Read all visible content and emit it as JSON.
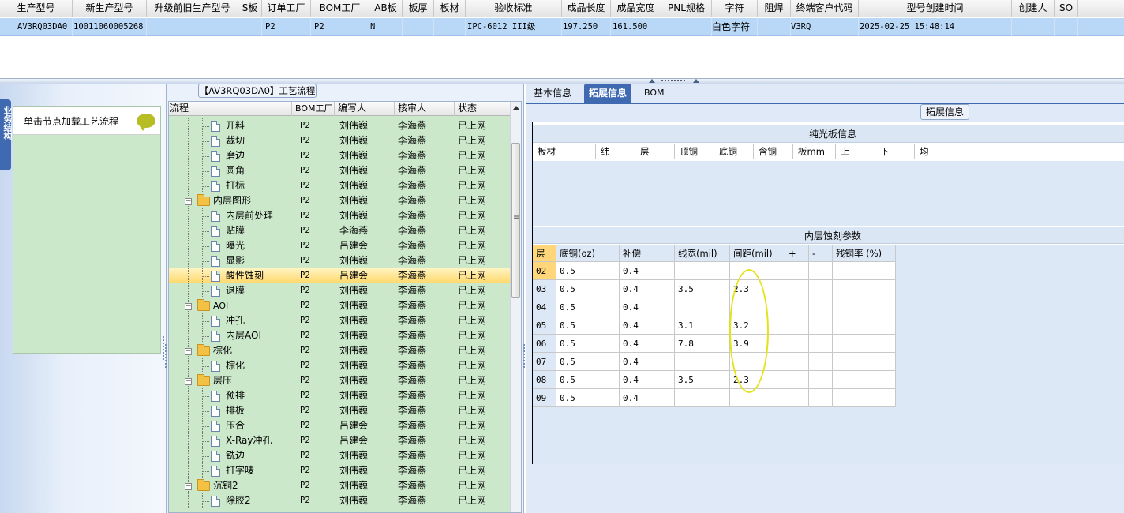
{
  "top_grid": {
    "columns": [
      "生产型号",
      "新生产型号",
      "升级前旧生产型号",
      "S板",
      "订单工厂",
      "BOM工厂",
      "AB板",
      "板厚",
      "板材",
      "验收标准",
      "成品长度",
      "成品宽度",
      "PNL规格",
      "字符",
      "阻焊",
      "终端客户代码",
      "型号创建时间",
      "创建人",
      "SO"
    ],
    "row": {
      "model": "AV3RQ03DA0",
      "new_model": "10011060005268",
      "order_factory": "P2",
      "bom_factory": "P2",
      "ab_board": "N",
      "standard": "IPC-6012 III级",
      "length": "197.250",
      "width": "161.500",
      "char": "白色字符",
      "customer_code": "V3RQ",
      "created": "2025-02-25 15:48:14"
    }
  },
  "left_nav": {
    "vtab_label": "业务结构",
    "header_text": "单击节点加载工艺流程"
  },
  "tree": {
    "title": "【AV3RQ03DA0】工艺流程",
    "columns": [
      "流程",
      "BOM工厂",
      "编写人",
      "核审人",
      "状态"
    ],
    "rows": [
      {
        "name": "开料",
        "factory": "P2",
        "writer": "刘伟巍",
        "reviewer": "李海燕",
        "status": "已上网",
        "level": 1,
        "type": "file"
      },
      {
        "name": "裁切",
        "factory": "P2",
        "writer": "刘伟巍",
        "reviewer": "李海燕",
        "status": "已上网",
        "level": 1,
        "type": "file"
      },
      {
        "name": "磨边",
        "factory": "P2",
        "writer": "刘伟巍",
        "reviewer": "李海燕",
        "status": "已上网",
        "level": 1,
        "type": "file"
      },
      {
        "name": "圆角",
        "factory": "P2",
        "writer": "刘伟巍",
        "reviewer": "李海燕",
        "status": "已上网",
        "level": 1,
        "type": "file"
      },
      {
        "name": "打标",
        "factory": "P2",
        "writer": "刘伟巍",
        "reviewer": "李海燕",
        "status": "已上网",
        "level": 1,
        "type": "file"
      },
      {
        "name": "内层图形",
        "factory": "P2",
        "writer": "刘伟巍",
        "reviewer": "李海燕",
        "status": "已上网",
        "level": 0,
        "type": "folder"
      },
      {
        "name": "内层前处理",
        "factory": "P2",
        "writer": "刘伟巍",
        "reviewer": "李海燕",
        "status": "已上网",
        "level": 1,
        "type": "file"
      },
      {
        "name": "贴膜",
        "factory": "P2",
        "writer": "李海燕",
        "reviewer": "李海燕",
        "status": "已上网",
        "level": 1,
        "type": "file"
      },
      {
        "name": "曝光",
        "factory": "P2",
        "writer": "吕建会",
        "reviewer": "李海燕",
        "status": "已上网",
        "level": 1,
        "type": "file"
      },
      {
        "name": "显影",
        "factory": "P2",
        "writer": "刘伟巍",
        "reviewer": "李海燕",
        "status": "已上网",
        "level": 1,
        "type": "file"
      },
      {
        "name": "酸性蚀刻",
        "factory": "P2",
        "writer": "吕建会",
        "reviewer": "李海燕",
        "status": "已上网",
        "level": 1,
        "type": "file",
        "selected": true
      },
      {
        "name": "退膜",
        "factory": "P2",
        "writer": "刘伟巍",
        "reviewer": "李海燕",
        "status": "已上网",
        "level": 1,
        "type": "file"
      },
      {
        "name": "AOI",
        "factory": "P2",
        "writer": "刘伟巍",
        "reviewer": "李海燕",
        "status": "已上网",
        "level": 0,
        "type": "folder"
      },
      {
        "name": "冲孔",
        "factory": "P2",
        "writer": "刘伟巍",
        "reviewer": "李海燕",
        "status": "已上网",
        "level": 1,
        "type": "file"
      },
      {
        "name": "内层AOI",
        "factory": "P2",
        "writer": "刘伟巍",
        "reviewer": "李海燕",
        "status": "已上网",
        "level": 1,
        "type": "file"
      },
      {
        "name": "棕化",
        "factory": "P2",
        "writer": "刘伟巍",
        "reviewer": "李海燕",
        "status": "已上网",
        "level": 0,
        "type": "folder"
      },
      {
        "name": "棕化",
        "factory": "P2",
        "writer": "刘伟巍",
        "reviewer": "李海燕",
        "status": "已上网",
        "level": 1,
        "type": "file"
      },
      {
        "name": "层压",
        "factory": "P2",
        "writer": "刘伟巍",
        "reviewer": "李海燕",
        "status": "已上网",
        "level": 0,
        "type": "folder"
      },
      {
        "name": "预排",
        "factory": "P2",
        "writer": "刘伟巍",
        "reviewer": "李海燕",
        "status": "已上网",
        "level": 1,
        "type": "file"
      },
      {
        "name": "排板",
        "factory": "P2",
        "writer": "刘伟巍",
        "reviewer": "李海燕",
        "status": "已上网",
        "level": 1,
        "type": "file"
      },
      {
        "name": "压合",
        "factory": "P2",
        "writer": "吕建会",
        "reviewer": "李海燕",
        "status": "已上网",
        "level": 1,
        "type": "file"
      },
      {
        "name": "X-Ray冲孔",
        "factory": "P2",
        "writer": "吕建会",
        "reviewer": "李海燕",
        "status": "已上网",
        "level": 1,
        "type": "file"
      },
      {
        "name": "铣边",
        "factory": "P2",
        "writer": "刘伟巍",
        "reviewer": "李海燕",
        "status": "已上网",
        "level": 1,
        "type": "file"
      },
      {
        "name": "打字唛",
        "factory": "P2",
        "writer": "刘伟巍",
        "reviewer": "李海燕",
        "status": "已上网",
        "level": 1,
        "type": "file"
      },
      {
        "name": "沉铜2",
        "factory": "P2",
        "writer": "刘伟巍",
        "reviewer": "李海燕",
        "status": "已上网",
        "level": 0,
        "type": "folder"
      },
      {
        "name": "除胶2",
        "factory": "P2",
        "writer": "刘伟巍",
        "reviewer": "李海燕",
        "status": "已上网",
        "level": 1,
        "type": "file"
      }
    ]
  },
  "right": {
    "tabs": [
      "基本信息",
      "拓展信息",
      "BOM"
    ],
    "active_tab": 1,
    "ext_title": "拓展信息",
    "section1": {
      "title": "纯光板信息",
      "columns": [
        "板材",
        "纬",
        "层",
        "顶铜",
        "底铜",
        "含铜",
        "板mm",
        "上",
        "下",
        "均"
      ]
    },
    "section2": {
      "title": "内层蚀刻参数",
      "columns": [
        "层",
        "底铜(oz)",
        "补偿",
        "线宽(mil)",
        "间距(mil)",
        "+",
        "-",
        "残铜率 (%)"
      ],
      "rows": [
        [
          "02",
          "0.5",
          "0.4",
          "",
          "",
          "",
          "",
          ""
        ],
        [
          "03",
          "0.5",
          "0.4",
          "3.5",
          "2.3",
          "",
          "",
          ""
        ],
        [
          "04",
          "0.5",
          "0.4",
          "",
          "",
          "",
          "",
          ""
        ],
        [
          "05",
          "0.5",
          "0.4",
          "3.1",
          "3.2",
          "",
          "",
          ""
        ],
        [
          "06",
          "0.5",
          "0.4",
          "7.8",
          "3.9",
          "",
          "",
          ""
        ],
        [
          "07",
          "0.5",
          "0.4",
          "",
          "",
          "",
          "",
          ""
        ],
        [
          "08",
          "0.5",
          "0.4",
          "3.5",
          "2.3",
          "",
          "",
          ""
        ],
        [
          "09",
          "0.5",
          "0.4",
          "",
          "",
          "",
          "",
          ""
        ]
      ]
    }
  }
}
